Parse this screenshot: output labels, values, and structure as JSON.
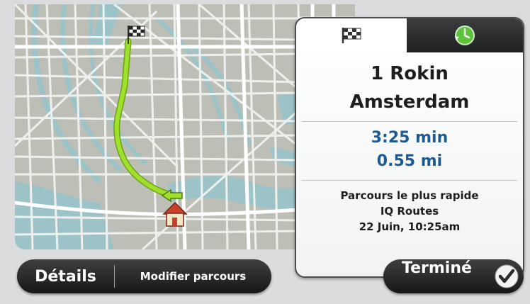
{
  "tabs": [
    {
      "icon": "checkered-flag-icon",
      "selected": true
    },
    {
      "icon": "clock-arrow-icon",
      "selected": false
    }
  ],
  "destination": {
    "street": "1 Rokin",
    "city": "Amsterdam"
  },
  "route": {
    "time": "3:25 min",
    "distance": "0.55 mi",
    "type": "Parcours le plus rapide",
    "traffic": "IQ Routes",
    "datetime": "22 Juin, 10:25am"
  },
  "buttons": {
    "details": "Détails",
    "modify": "Modifier parcours",
    "done": "Terminé"
  },
  "colors": {
    "route": "#9fe02a",
    "water": "#9cc4c8",
    "time_text": "#1d5a94"
  }
}
